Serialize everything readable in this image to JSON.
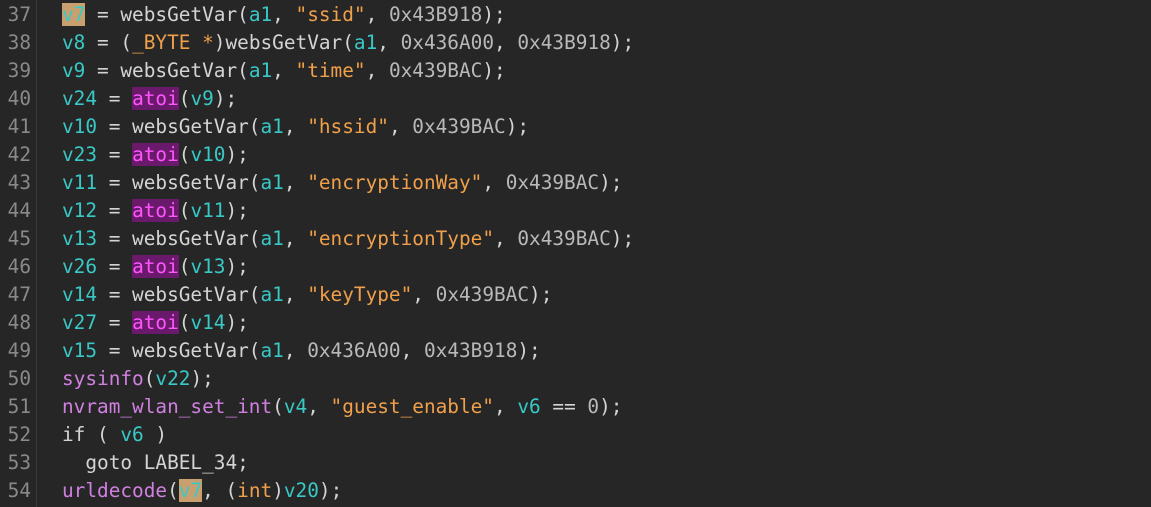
{
  "editor": {
    "lines": [
      {
        "num": "37",
        "tokens": [
          {
            "t": "v7",
            "c": "hl"
          },
          {
            "t": " = websGetVar(",
            "c": "default"
          },
          {
            "t": "a1",
            "c": "var"
          },
          {
            "t": ", ",
            "c": "default"
          },
          {
            "t": "\"ssid\"",
            "c": "str"
          },
          {
            "t": ", ",
            "c": "default"
          },
          {
            "t": "0x43B918",
            "c": "num"
          },
          {
            "t": ");",
            "c": "default"
          }
        ]
      },
      {
        "num": "38",
        "tokens": [
          {
            "t": "v8",
            "c": "var"
          },
          {
            "t": " = (",
            "c": "default"
          },
          {
            "t": "_BYTE *",
            "c": "type"
          },
          {
            "t": ")websGetVar(",
            "c": "default"
          },
          {
            "t": "a1",
            "c": "var"
          },
          {
            "t": ", ",
            "c": "default"
          },
          {
            "t": "0x436A00",
            "c": "num"
          },
          {
            "t": ", ",
            "c": "default"
          },
          {
            "t": "0x43B918",
            "c": "num"
          },
          {
            "t": ");",
            "c": "default"
          }
        ]
      },
      {
        "num": "39",
        "tokens": [
          {
            "t": "v9",
            "c": "var"
          },
          {
            "t": " = websGetVar(",
            "c": "default"
          },
          {
            "t": "a1",
            "c": "var"
          },
          {
            "t": ", ",
            "c": "default"
          },
          {
            "t": "\"time\"",
            "c": "str"
          },
          {
            "t": ", ",
            "c": "default"
          },
          {
            "t": "0x439BAC",
            "c": "num"
          },
          {
            "t": ");",
            "c": "default"
          }
        ]
      },
      {
        "num": "40",
        "tokens": [
          {
            "t": "v24",
            "c": "var"
          },
          {
            "t": " = ",
            "c": "default"
          },
          {
            "t": "atoi",
            "c": "import"
          },
          {
            "t": "(",
            "c": "default"
          },
          {
            "t": "v9",
            "c": "var"
          },
          {
            "t": ");",
            "c": "default"
          }
        ]
      },
      {
        "num": "41",
        "tokens": [
          {
            "t": "v10",
            "c": "var"
          },
          {
            "t": " = websGetVar(",
            "c": "default"
          },
          {
            "t": "a1",
            "c": "var"
          },
          {
            "t": ", ",
            "c": "default"
          },
          {
            "t": "\"hssid\"",
            "c": "str"
          },
          {
            "t": ", ",
            "c": "default"
          },
          {
            "t": "0x439BAC",
            "c": "num"
          },
          {
            "t": ");",
            "c": "default"
          }
        ]
      },
      {
        "num": "42",
        "tokens": [
          {
            "t": "v23",
            "c": "var"
          },
          {
            "t": " = ",
            "c": "default"
          },
          {
            "t": "atoi",
            "c": "import"
          },
          {
            "t": "(",
            "c": "default"
          },
          {
            "t": "v10",
            "c": "var"
          },
          {
            "t": ");",
            "c": "default"
          }
        ]
      },
      {
        "num": "43",
        "tokens": [
          {
            "t": "v11",
            "c": "var"
          },
          {
            "t": " = websGetVar(",
            "c": "default"
          },
          {
            "t": "a1",
            "c": "var"
          },
          {
            "t": ", ",
            "c": "default"
          },
          {
            "t": "\"encryptionWay\"",
            "c": "str"
          },
          {
            "t": ", ",
            "c": "default"
          },
          {
            "t": "0x439BAC",
            "c": "num"
          },
          {
            "t": ");",
            "c": "default"
          }
        ]
      },
      {
        "num": "44",
        "tokens": [
          {
            "t": "v12",
            "c": "var"
          },
          {
            "t": " = ",
            "c": "default"
          },
          {
            "t": "atoi",
            "c": "import"
          },
          {
            "t": "(",
            "c": "default"
          },
          {
            "t": "v11",
            "c": "var"
          },
          {
            "t": ");",
            "c": "default"
          }
        ]
      },
      {
        "num": "45",
        "tokens": [
          {
            "t": "v13",
            "c": "var"
          },
          {
            "t": " = websGetVar(",
            "c": "default"
          },
          {
            "t": "a1",
            "c": "var"
          },
          {
            "t": ", ",
            "c": "default"
          },
          {
            "t": "\"encryptionType\"",
            "c": "str"
          },
          {
            "t": ", ",
            "c": "default"
          },
          {
            "t": "0x439BAC",
            "c": "num"
          },
          {
            "t": ");",
            "c": "default"
          }
        ]
      },
      {
        "num": "46",
        "tokens": [
          {
            "t": "v26",
            "c": "var"
          },
          {
            "t": " = ",
            "c": "default"
          },
          {
            "t": "atoi",
            "c": "import"
          },
          {
            "t": "(",
            "c": "default"
          },
          {
            "t": "v13",
            "c": "var"
          },
          {
            "t": ");",
            "c": "default"
          }
        ]
      },
      {
        "num": "47",
        "tokens": [
          {
            "t": "v14",
            "c": "var"
          },
          {
            "t": " = websGetVar(",
            "c": "default"
          },
          {
            "t": "a1",
            "c": "var"
          },
          {
            "t": ", ",
            "c": "default"
          },
          {
            "t": "\"keyType\"",
            "c": "str"
          },
          {
            "t": ", ",
            "c": "default"
          },
          {
            "t": "0x439BAC",
            "c": "num"
          },
          {
            "t": ");",
            "c": "default"
          }
        ]
      },
      {
        "num": "48",
        "tokens": [
          {
            "t": "v27",
            "c": "var"
          },
          {
            "t": " = ",
            "c": "default"
          },
          {
            "t": "atoi",
            "c": "import"
          },
          {
            "t": "(",
            "c": "default"
          },
          {
            "t": "v14",
            "c": "var"
          },
          {
            "t": ");",
            "c": "default"
          }
        ]
      },
      {
        "num": "49",
        "tokens": [
          {
            "t": "v15",
            "c": "var"
          },
          {
            "t": " = websGetVar(",
            "c": "default"
          },
          {
            "t": "a1",
            "c": "var"
          },
          {
            "t": ", ",
            "c": "default"
          },
          {
            "t": "0x436A00",
            "c": "num"
          },
          {
            "t": ", ",
            "c": "default"
          },
          {
            "t": "0x43B918",
            "c": "num"
          },
          {
            "t": ");",
            "c": "default"
          }
        ]
      },
      {
        "num": "50",
        "tokens": [
          {
            "t": "sysinfo",
            "c": "call"
          },
          {
            "t": "(",
            "c": "default"
          },
          {
            "t": "v22",
            "c": "var"
          },
          {
            "t": ");",
            "c": "default"
          }
        ]
      },
      {
        "num": "51",
        "tokens": [
          {
            "t": "nvram_wlan_set_int",
            "c": "call"
          },
          {
            "t": "(",
            "c": "default"
          },
          {
            "t": "v4",
            "c": "var"
          },
          {
            "t": ", ",
            "c": "default"
          },
          {
            "t": "\"guest_enable\"",
            "c": "str"
          },
          {
            "t": ", ",
            "c": "default"
          },
          {
            "t": "v6",
            "c": "var"
          },
          {
            "t": " == ",
            "c": "default"
          },
          {
            "t": "0",
            "c": "num"
          },
          {
            "t": ");",
            "c": "default"
          }
        ]
      },
      {
        "num": "52",
        "tokens": [
          {
            "t": "if ( ",
            "c": "default"
          },
          {
            "t": "v6",
            "c": "var"
          },
          {
            "t": " )",
            "c": "default"
          }
        ]
      },
      {
        "num": "53",
        "tokens": [
          {
            "t": "  goto LABEL_34;",
            "c": "default"
          }
        ]
      },
      {
        "num": "54",
        "tokens": [
          {
            "t": "urldecode",
            "c": "call"
          },
          {
            "t": "(",
            "c": "default"
          },
          {
            "t": "v7",
            "c": "hl"
          },
          {
            "t": ", (",
            "c": "default"
          },
          {
            "t": "int",
            "c": "type"
          },
          {
            "t": ")",
            "c": "default"
          },
          {
            "t": "v20",
            "c": "var"
          },
          {
            "t": ");",
            "c": "default"
          }
        ]
      }
    ]
  }
}
